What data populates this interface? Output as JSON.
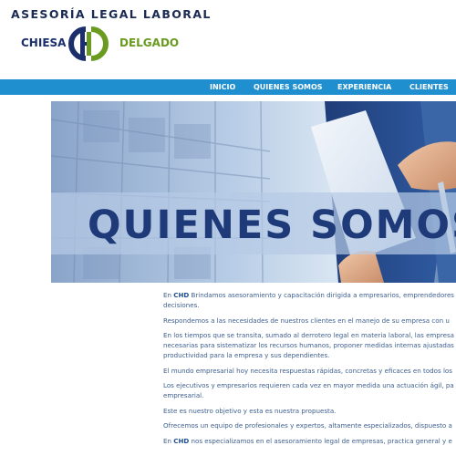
{
  "header": {
    "title": "ASESORÍA LEGAL LABORAL",
    "logo": {
      "left_text": "CHIESA",
      "right_text": "DELGADO",
      "mark_text": "CHD",
      "colors": {
        "navy": "#1a2f6c",
        "green": "#6a9a1f"
      }
    }
  },
  "nav": {
    "items": [
      {
        "label": "INICIO"
      },
      {
        "label": "QUIENES SOMOS"
      },
      {
        "label": "EXPERIENCIA"
      },
      {
        "label": "CLIENTES"
      }
    ],
    "color": "#1f8fcf"
  },
  "hero": {
    "title": "QUIENES SOMOS"
  },
  "content": {
    "paragraphs": [
      {
        "lines": [
          {
            "prefix": "En ",
            "bold": "CHD",
            "rest": " Brindamos asesoramiento y capacitación dirigida a empresarios, emprendedores"
          },
          {
            "text": "decisiones."
          }
        ]
      },
      {
        "lines": [
          {
            "text": "Respondemos a las necesidades de nuestros clientes en el manejo de su empresa con u"
          }
        ]
      },
      {
        "lines": [
          {
            "text": "En los tiempos que se transita, sumado al derrotero legal en materia laboral, las empresa"
          },
          {
            "text": "necesarias para sistematizar los recursos humanos, proponer medidas internas ajustadas"
          },
          {
            "text": "productividad para la empresa y sus dependientes."
          }
        ]
      },
      {
        "lines": [
          {
            "text": "El mundo empresarial hoy necesita respuestas rápidas, concretas y eficaces en todos los"
          }
        ]
      },
      {
        "lines": [
          {
            "text": "Los ejecutivos y empresarios requieren cada vez en mayor medida una actuación ágil, pa"
          },
          {
            "text": "empresarial."
          }
        ]
      },
      {
        "lines": [
          {
            "text": "Este es nuestro objetivo y esta es nuestra propuesta."
          }
        ]
      },
      {
        "lines": [
          {
            "text": "Ofrecemos un equipo de profesionales y expertos, altamente especializados, dispuesto a"
          }
        ]
      },
      {
        "lines": [
          {
            "prefix": "En ",
            "bold": "CHD",
            "rest": " nos especializamos en el asesoramiento legal de empresas, practica general y e"
          }
        ]
      }
    ]
  }
}
